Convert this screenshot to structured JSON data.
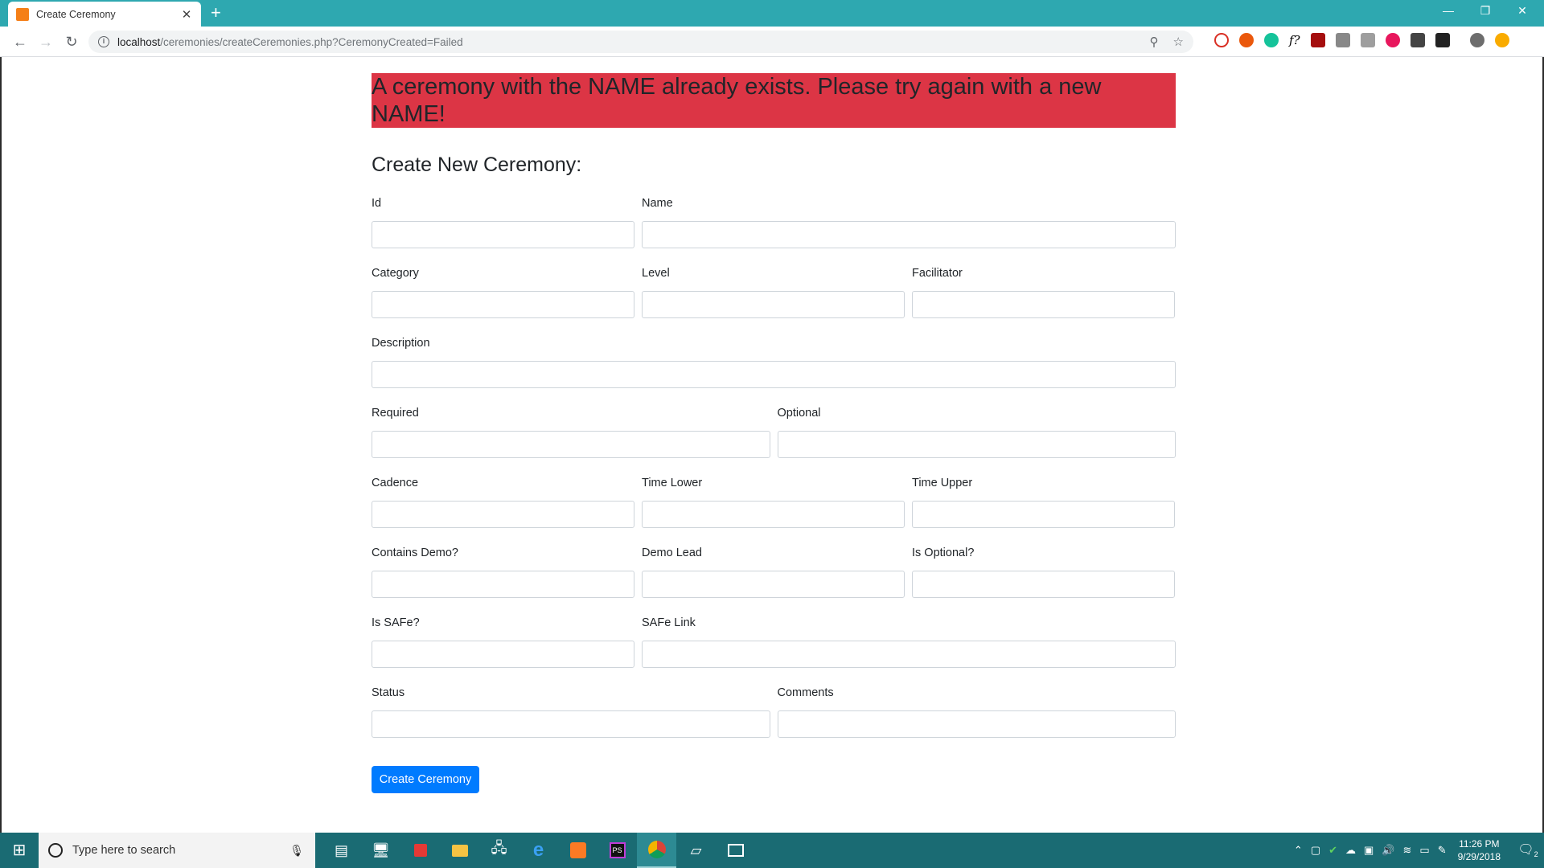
{
  "browser": {
    "tab_title": "Create Ceremony",
    "tab_close": "✕",
    "new_tab": "+",
    "url_host": "localhost",
    "url_path": "/ceremonies/createCeremonies.php?CeremonyCreated=Failed",
    "window_min": "—",
    "window_restore": "❐",
    "window_close": "✕"
  },
  "page": {
    "alert": "A ceremony with the NAME already exists. Please try again with a new NAME!",
    "heading": "Create New Ceremony:",
    "fields": {
      "id": "Id",
      "name": "Name",
      "category": "Category",
      "level": "Level",
      "facilitator": "Facilitator",
      "description": "Description",
      "required": "Required",
      "optional": "Optional",
      "cadence": "Cadence",
      "time_lower": "Time Lower",
      "time_upper": "Time Upper",
      "contains_demo": "Contains Demo?",
      "demo_lead": "Demo Lead",
      "is_optional": "Is Optional?",
      "is_safe": "Is SAFe?",
      "safe_link": "SAFe Link",
      "status": "Status",
      "comments": "Comments"
    },
    "submit_label": "Create Ceremony"
  },
  "taskbar": {
    "search_placeholder": "Type here to search",
    "time": "11:26 PM",
    "date": "9/29/2018",
    "notification_count": "2"
  },
  "colors": {
    "alert_bg": "#dc3545",
    "button_bg": "#007bff",
    "titlebar_bg": "#2ea8b0",
    "taskbar_bg": "#1a6b73"
  }
}
